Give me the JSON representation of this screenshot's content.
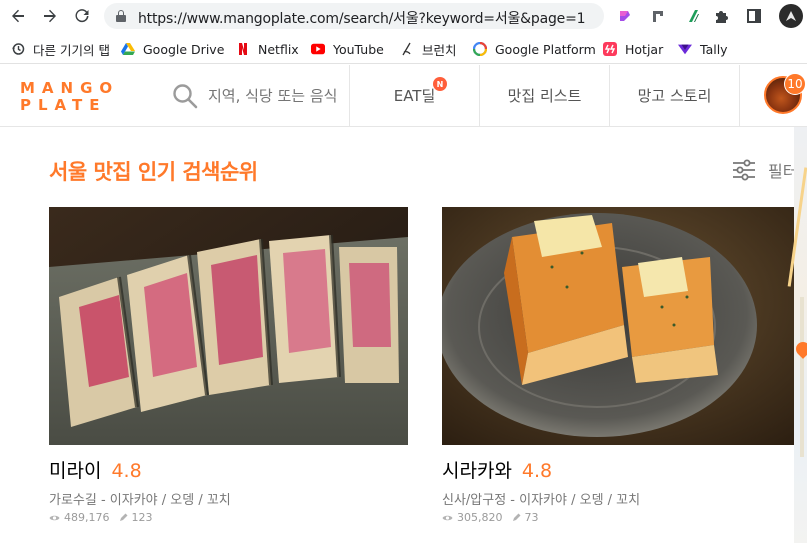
{
  "browser": {
    "url": "https://www.mangoplate.com/search/서울?keyword=서울&page=1",
    "bookmarks": [
      {
        "label": "다른 기기의 탭",
        "icon": "history-icon"
      },
      {
        "label": "Google Drive",
        "icon": "google-drive-icon"
      },
      {
        "label": "Netflix",
        "icon": "netflix-icon"
      },
      {
        "label": "YouTube",
        "icon": "youtube-icon"
      },
      {
        "label": "브런치",
        "icon": "brunch-icon"
      },
      {
        "label": "Google Platform",
        "icon": "google-platform-icon"
      },
      {
        "label": "Hotjar",
        "icon": "hotjar-icon"
      },
      {
        "label": "Tally",
        "icon": "tally-icon"
      }
    ]
  },
  "header": {
    "logo_line1": "MANGO",
    "logo_line2": "PLATE",
    "search_placeholder": "지역, 식당 또는 음식",
    "nav": [
      {
        "label": "EAT딜",
        "badge": "N"
      },
      {
        "label": "맛집 리스트"
      },
      {
        "label": "망고 스토리"
      }
    ],
    "notification_count": "10"
  },
  "main": {
    "title": "서울 맛집 인기 검색순위",
    "filter_label": "필터",
    "restaurants": [
      {
        "name": "미라이",
        "rating": "4.8",
        "meta": "가로수길 - 이자카야 / 오뎅 / 꼬치",
        "views": "489,176",
        "reviews": "123"
      },
      {
        "name": "시라카와",
        "rating": "4.8",
        "meta": "신사/압구정 - 이자카야 / 오뎅 / 꼬치",
        "views": "305,820",
        "reviews": "73"
      }
    ]
  },
  "colors": {
    "brand": "#ff792a",
    "text_muted": "#777777"
  }
}
